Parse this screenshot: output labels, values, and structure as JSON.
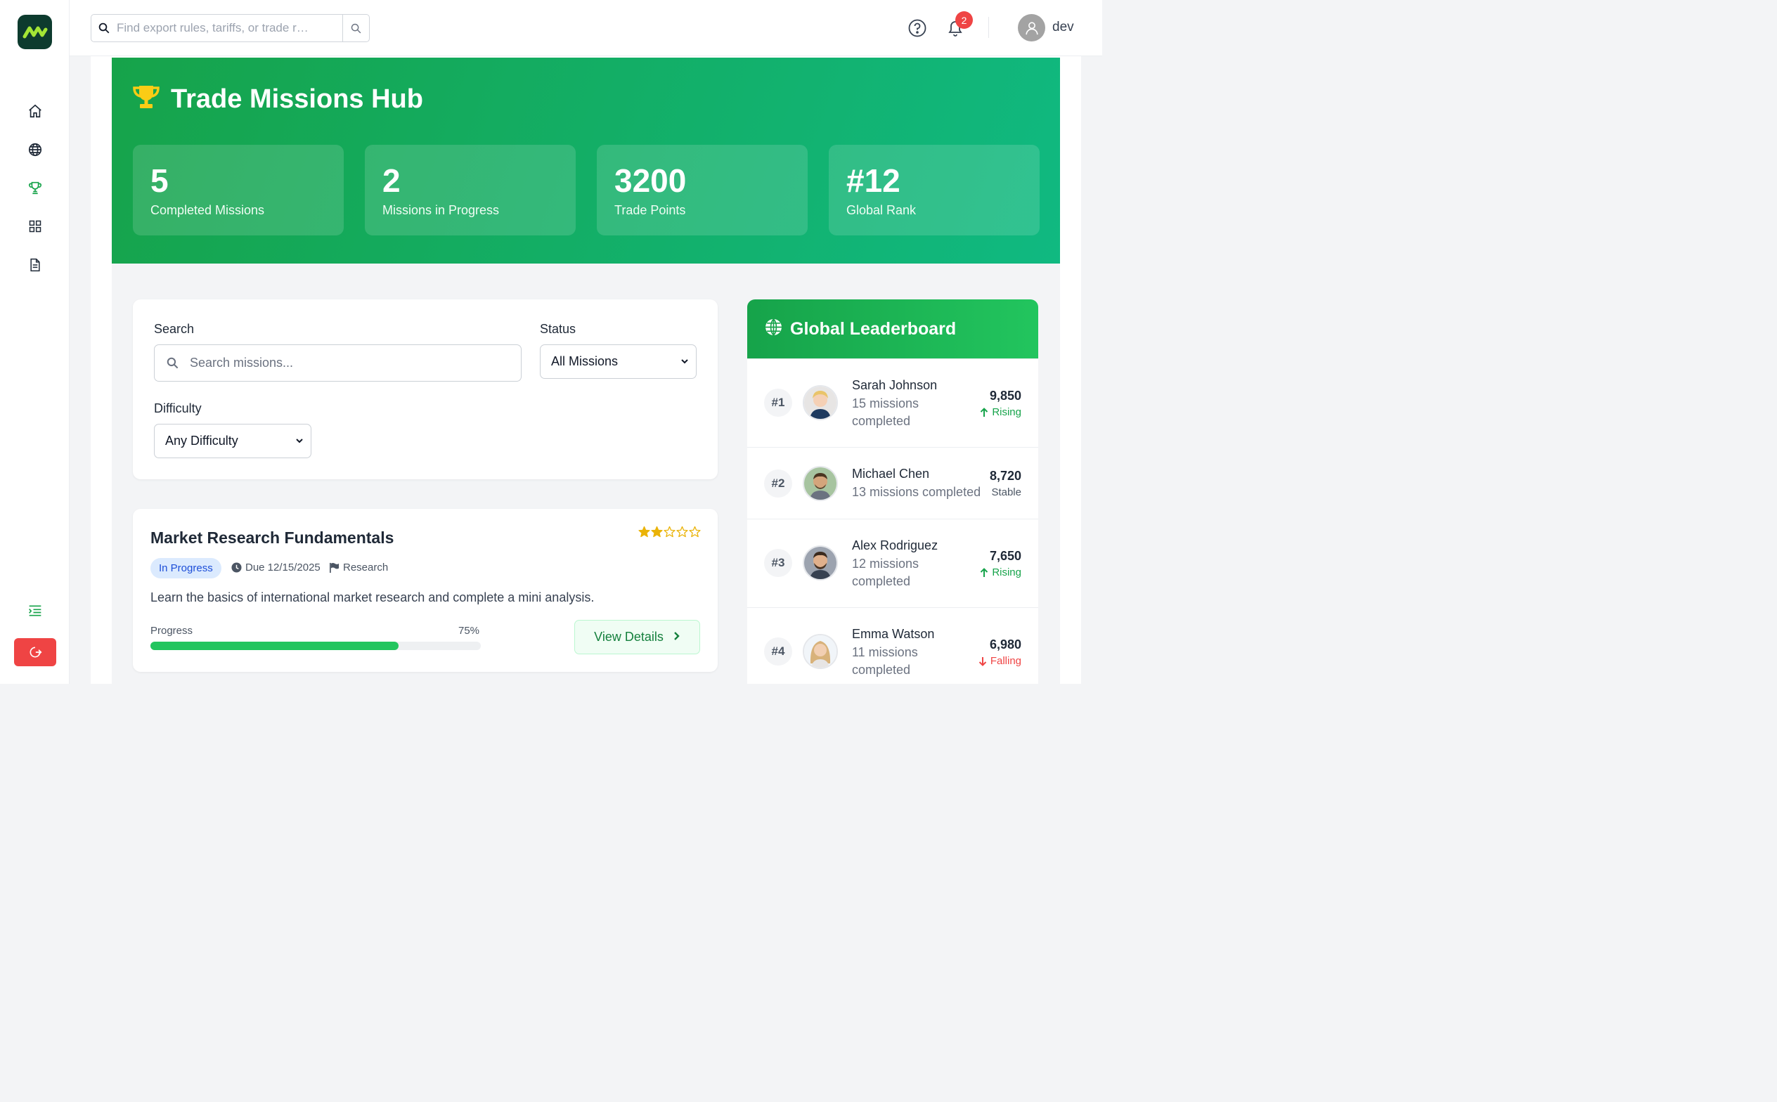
{
  "topbar": {
    "search_placeholder": "Find export rules, tariffs, or trade r…",
    "notification_count": "2",
    "username": "dev"
  },
  "hero": {
    "title": "Trade Missions Hub",
    "stats": [
      {
        "value": "5",
        "label": "Completed Missions"
      },
      {
        "value": "2",
        "label": "Missions in Progress"
      },
      {
        "value": "3200",
        "label": "Trade Points"
      },
      {
        "value": "#12",
        "label": "Global Rank"
      }
    ]
  },
  "filters": {
    "search_label": "Search",
    "search_placeholder": "Search missions...",
    "status_label": "Status",
    "status_value": "All Missions",
    "difficulty_label": "Difficulty",
    "difficulty_value": "Any Difficulty"
  },
  "mission": {
    "title": "Market Research Fundamentals",
    "status": "In Progress",
    "due": "Due 12/15/2025",
    "category": "Research",
    "description": "Learn the basics of international market research and complete a mini analysis.",
    "progress_label": "Progress",
    "progress_text": "75%",
    "progress": 0.75,
    "rating": 2,
    "rating_max": 5,
    "button_label": "View Details"
  },
  "leaderboard": {
    "title": "Global Leaderboard",
    "entries": [
      {
        "rank": "#1",
        "name": "Sarah Johnson",
        "line1": "15 missions",
        "line2": "completed",
        "points": "9,850",
        "trend": "Rising"
      },
      {
        "rank": "#2",
        "name": "Michael Chen",
        "line1": "13 missions completed",
        "line2": "",
        "points": "8,720",
        "trend": "Stable"
      },
      {
        "rank": "#3",
        "name": "Alex Rodriguez",
        "line1": "12 missions",
        "line2": "completed",
        "points": "7,650",
        "trend": "Rising"
      },
      {
        "rank": "#4",
        "name": "Emma Watson",
        "line1": "11 missions",
        "line2": "completed",
        "points": "6,980",
        "trend": "Falling"
      }
    ]
  },
  "colors": {
    "brand_green": "#16a34a",
    "progress_green": "#22c55e",
    "rising": "#16a34a",
    "falling": "#ef4444",
    "star": "#eab308",
    "logout": "#ef4444"
  }
}
